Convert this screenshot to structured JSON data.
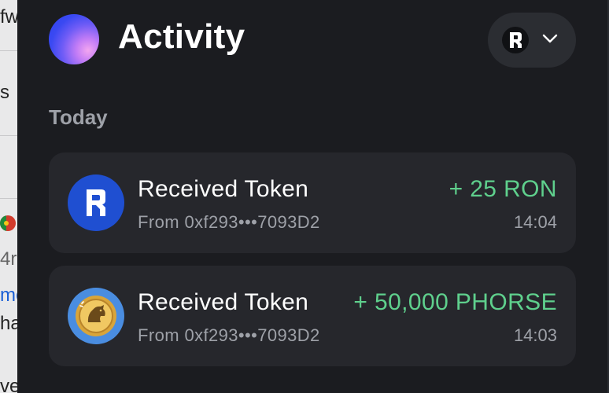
{
  "background_fragments": [
    "fw",
    "s",
    "4r",
    "me",
    "ha",
    "ve"
  ],
  "header": {
    "title": "Activity",
    "network_icon": "ronin-icon",
    "dropdown_icon": "chevron-down-icon"
  },
  "section": {
    "label": "Today"
  },
  "transactions": [
    {
      "label": "Received Token",
      "from": "From 0xf293•••7093D2",
      "amount": "+ 25 RON",
      "time": "14:04",
      "icon": "ron-token-icon"
    },
    {
      "label": "Received Token",
      "from": "From 0xf293•••7093D2",
      "amount": "+ 50,000 PHORSE",
      "time": "14:03",
      "icon": "phorse-token-icon"
    }
  ],
  "colors": {
    "panel_bg": "#1b1c20",
    "card_bg": "#26272c",
    "amount_green": "#5fd08d",
    "muted_text": "#9ea1a8",
    "ron_blue": "#1f4fd1"
  }
}
